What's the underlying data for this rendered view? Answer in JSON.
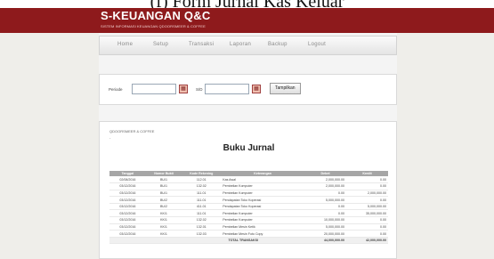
{
  "caption": "(f)  Form Jurnal Kas Keluar",
  "header": {
    "title": "S-KEUANGAN Q&C",
    "subtitle": "SISTEM INFORMASI KEUANGAN QDOORSMEER & COFFEE"
  },
  "nav": [
    "Home",
    "Setup",
    "Transaksi",
    "Laporan",
    "Backup",
    "Logout"
  ],
  "filter": {
    "periode_label": "Periode",
    "sd_label": "S/D",
    "button": "Tampilkan"
  },
  "report": {
    "company": "QDOORSMEER & COFFEE",
    "dash": "-",
    "title": "Buku Jurnal",
    "columns": [
      "Tanggal",
      "Nomor Bukti",
      "Kode Rekening",
      "Keterangan",
      "Debet",
      "Kredit"
    ],
    "rows": [
      [
        "02/08/2016",
        "BU/1",
        "112.01",
        "Kas Awal",
        "2,000,000.00",
        "0.00"
      ],
      [
        "03/12/2016",
        "BU/1",
        "132.02",
        "Pembelian Komputer",
        "2,000,000.00",
        "0.00"
      ],
      [
        "03/12/2016",
        "BU/1",
        "111.01",
        "Pembelian Komputer",
        "0.00",
        "2,000,000.00"
      ],
      [
        "03/12/2016",
        "BU/2",
        "111.01",
        "Pendapatan Toko Koperasi",
        "5,000,000.00",
        "0.00"
      ],
      [
        "03/12/2016",
        "BU/2",
        "411.01",
        "Pendapatan Toko Koperasi",
        "0.00",
        "5,000,000.00"
      ],
      [
        "03/12/2016",
        "KK/1",
        "111.01",
        "Pembelian Komputer",
        "0.00",
        "35,000,000.00"
      ],
      [
        "03/12/2016",
        "KK/1",
        "132.02",
        "Pembelian Komputer",
        "10,000,000.00",
        "0.00"
      ],
      [
        "03/12/2016",
        "KK/1",
        "132.01",
        "Pembelian Mesin Ketik",
        "5,000,000.00",
        "0.00"
      ],
      [
        "03/12/2016",
        "KK/1",
        "132.03",
        "Pembelian Mesin Foto Copy",
        "20,000,000.00",
        "0.00"
      ]
    ],
    "total_label": "TOTAL TRANSAKSI",
    "total_debet": "44,000,000.00",
    "total_kredit": "42,000,000.00"
  },
  "colors": {
    "header_bg": "#8e1a1c",
    "page_bg": "#efeeea",
    "table_header_bg": "#a6a6a6"
  }
}
